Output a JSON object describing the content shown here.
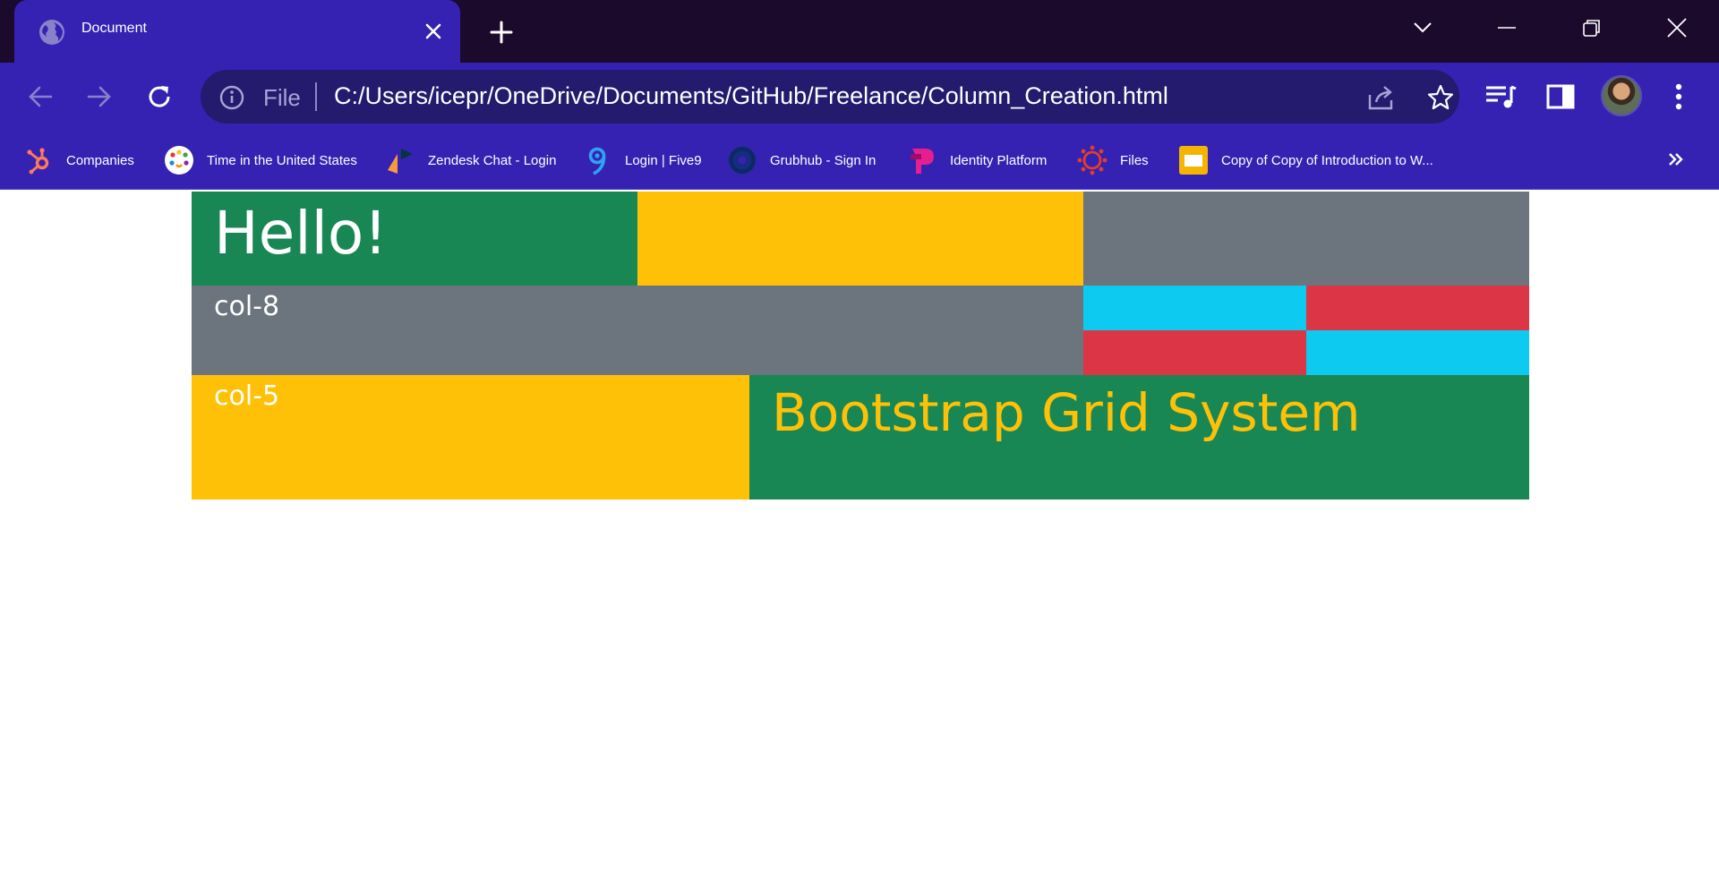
{
  "browser": {
    "tab": {
      "title": "Document",
      "favicon": "globe-icon"
    },
    "address": {
      "scheme": "File",
      "url": "C:/Users/icepr/OneDrive/Documents/GitHub/Freelance/Column_Creation.html"
    },
    "bookmarks": [
      {
        "label": "Companies",
        "icon": "hubspot-icon"
      },
      {
        "label": "Time in the United States",
        "icon": "clock-icon"
      },
      {
        "label": "Zendesk Chat - Login",
        "icon": "zendesk-icon"
      },
      {
        "label": "Login | Five9",
        "icon": "five9-icon"
      },
      {
        "label": "Grubhub - Sign In",
        "icon": "grubhub-icon"
      },
      {
        "label": "Identity Platform",
        "icon": "identity-icon"
      },
      {
        "label": "Files",
        "icon": "canvas-icon"
      },
      {
        "label": "Copy of Copy of Introduction to W...",
        "icon": "slides-icon"
      }
    ]
  },
  "page": {
    "row1": {
      "heading": "Hello!"
    },
    "row2": {
      "label": "col-8"
    },
    "row3": {
      "label": "col-5",
      "heading": "Bootstrap Grid System"
    }
  },
  "colors": {
    "chrome_dark": "#1c0a2d",
    "chrome_accent": "#3522b3",
    "success": "#198754",
    "warning": "#ffc107",
    "secondary": "#6c757d",
    "info": "#0dcaf0",
    "danger": "#dc3545"
  }
}
